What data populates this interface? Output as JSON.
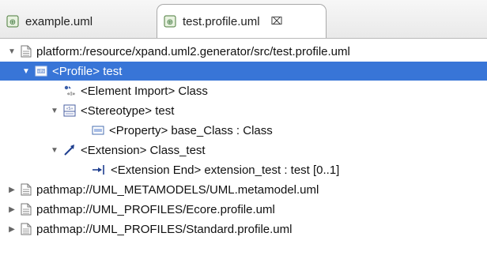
{
  "tabs": [
    {
      "label": "example.uml",
      "icon": "uml-file-icon",
      "active": false
    },
    {
      "label": "test.profile.uml",
      "icon": "uml-file-icon",
      "active": true,
      "close_glyph": "⌧"
    }
  ],
  "tree": {
    "root": {
      "label": "platform:/resource/xpand.uml2.generator/src/test.profile.uml",
      "icon": "document-icon",
      "expanded": true
    },
    "profile": {
      "label": "<Profile> test",
      "icon": "profile-icon",
      "expanded": true,
      "selected": true
    },
    "element_import": {
      "label": "<Element Import> Class",
      "icon": "element-import-icon"
    },
    "stereotype": {
      "label": "<Stereotype> test",
      "icon": "stereotype-icon",
      "expanded": true
    },
    "property": {
      "label": "<Property> base_Class : Class",
      "icon": "property-icon"
    },
    "extension": {
      "label": "<Extension> Class_test",
      "icon": "extension-icon",
      "expanded": true
    },
    "extension_end": {
      "label": "<Extension End> extension_test : test [0..1]",
      "icon": "extension-end-icon"
    },
    "resources": [
      {
        "label": "pathmap://UML_METAMODELS/UML.metamodel.uml",
        "icon": "document-icon",
        "expanded": false
      },
      {
        "label": "pathmap://UML_PROFILES/Ecore.profile.uml",
        "icon": "document-icon",
        "expanded": false
      },
      {
        "label": "pathmap://UML_PROFILES/Standard.profile.uml",
        "icon": "document-icon",
        "expanded": false
      }
    ]
  },
  "colors": {
    "selection": "#3875d7",
    "tab_icon": "#2e8b3e"
  }
}
